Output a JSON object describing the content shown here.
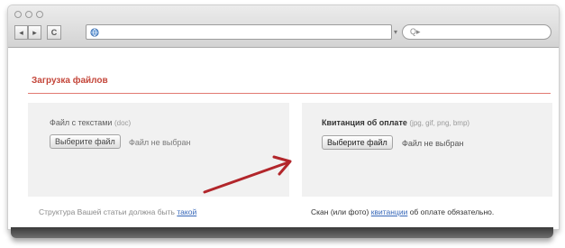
{
  "browser": {
    "nav_back": "◂",
    "nav_forward": "▸",
    "reload": "C",
    "search_placeholder": "Q▸",
    "url_dropdown": "▾"
  },
  "section": {
    "title": "Загрузка файлов"
  },
  "left_panel": {
    "label": "Файл с текстами",
    "hint": "(doc)",
    "button": "Выберите файл",
    "status": "Файл не выбран"
  },
  "right_panel": {
    "label": "Квитанция об оплате",
    "hint": "(jpg, gif, png, bmp)",
    "button": "Выберите файл",
    "status": "Файл не выбран"
  },
  "footer": {
    "left_text": "Структура Вашей статьи должна быть",
    "left_link": "такой",
    "right_text_1": "Скан (или фото)",
    "right_link": "квитанции",
    "right_text_2": "об оплате обязательно."
  },
  "colors": {
    "accent": "#c4463a",
    "arrow": "#b2262b",
    "link": "#3566b8"
  }
}
